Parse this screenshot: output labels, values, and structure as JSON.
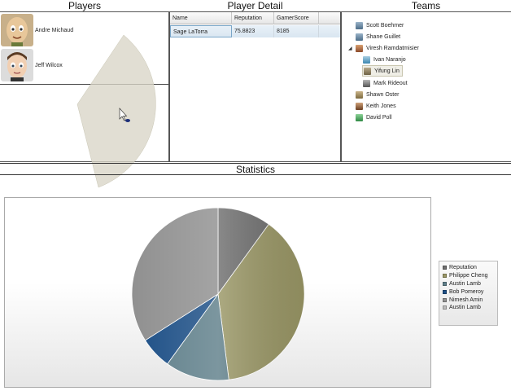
{
  "headers": {
    "players": "Players",
    "detail": "Player Detail",
    "teams": "Teams",
    "statistics": "Statistics"
  },
  "players": [
    {
      "name": "Andre Michaud",
      "avatar": "avatar-bald"
    },
    {
      "name": "Jeff Wilcox",
      "avatar": "avatar-hair"
    }
  ],
  "detail": {
    "columns": [
      "Name",
      "Reputation",
      "GamerScore"
    ],
    "rows": [
      {
        "name": "Sage LaTorra",
        "reputation": "75.8823",
        "gamerscore": "8185"
      }
    ]
  },
  "teams": {
    "nodes": [
      {
        "label": "Scott Boehmer"
      },
      {
        "label": "Shane Guillet"
      },
      {
        "label": "Viresh Ramdatmisier",
        "expanded": true
      },
      {
        "label": "Ivan Naranjo"
      },
      {
        "label": "Yifung Lin",
        "selected": true
      },
      {
        "label": "Mark Rideout"
      },
      {
        "label": "Shawn Oster"
      },
      {
        "label": "Keith Jones"
      },
      {
        "label": "David Poll"
      }
    ]
  },
  "chart_data": {
    "type": "pie",
    "title": "",
    "series": [
      {
        "name": "Reputation",
        "value": 10,
        "color": "#6f6f6f"
      },
      {
        "name": "Philippe Cheng",
        "value": 38,
        "color": "#9a9766"
      },
      {
        "name": "Austin Lamb",
        "value": 12,
        "color": "#5f7f8a"
      },
      {
        "name": "Bob Pomeroy",
        "value": 6,
        "color": "#1d4f86"
      },
      {
        "name": "Nimesh Amin",
        "value": 34,
        "color": "#909090"
      },
      {
        "name": "Austin Lamb",
        "value": 0,
        "color": "#bdbdbd"
      }
    ],
    "legend": "right"
  }
}
